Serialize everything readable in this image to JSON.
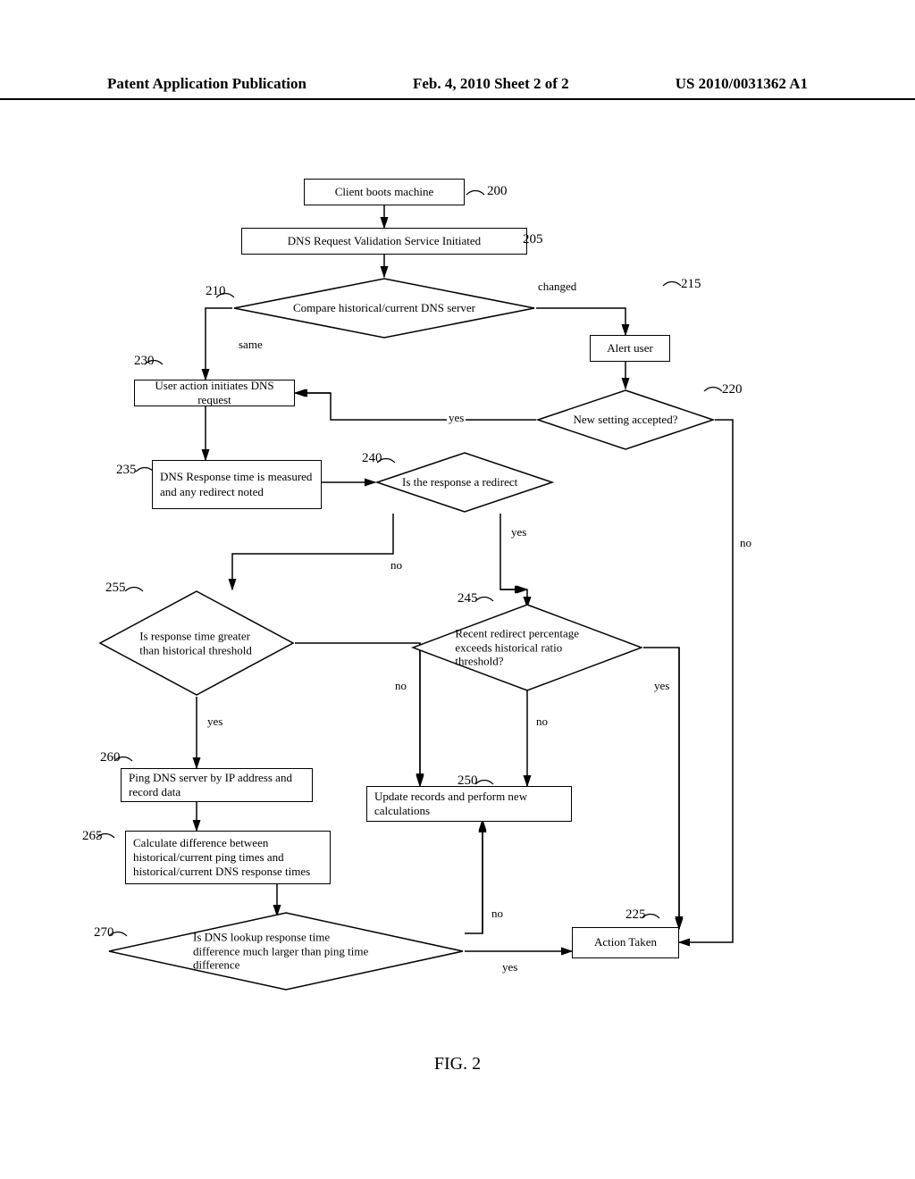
{
  "header": {
    "left": "Patent Application Publication",
    "center": "Feb. 4, 2010  Sheet 2 of 2",
    "right": "US 2010/0031362 A1"
  },
  "figure_caption": "FIG. 2",
  "nodes": {
    "n200": {
      "ref": "200",
      "text": "Client boots machine"
    },
    "n205": {
      "ref": "205",
      "text": "DNS Request Validation Service Initiated"
    },
    "n210": {
      "ref": "210",
      "text": "Compare historical/current DNS server"
    },
    "n215": {
      "ref": "215",
      "text": "Alert user"
    },
    "n220": {
      "ref": "220",
      "text": "New setting accepted?"
    },
    "n225": {
      "ref": "225",
      "text": "Action Taken"
    },
    "n230": {
      "ref": "230",
      "text": "User action initiates DNS request"
    },
    "n235": {
      "ref": "235",
      "text": "DNS Response time is measured and any redirect noted"
    },
    "n240": {
      "ref": "240",
      "text": "Is the response a redirect"
    },
    "n245": {
      "ref": "245",
      "text": "Recent redirect percentage exceeds historical ratio threshold?"
    },
    "n250": {
      "ref": "250",
      "text": "Update records and perform new calculations"
    },
    "n255": {
      "ref": "255",
      "text": "Is response time greater than historical threshold"
    },
    "n260": {
      "ref": "260",
      "text": "Ping DNS server by IP address and record data"
    },
    "n265": {
      "ref": "265",
      "text": "Calculate difference between historical/current ping times and historical/current DNS response times"
    },
    "n270": {
      "ref": "270",
      "text": "Is DNS lookup response time difference much larger than ping time difference"
    }
  },
  "edges": {
    "changed": "changed",
    "same": "same",
    "yes": "yes",
    "no": "no"
  }
}
